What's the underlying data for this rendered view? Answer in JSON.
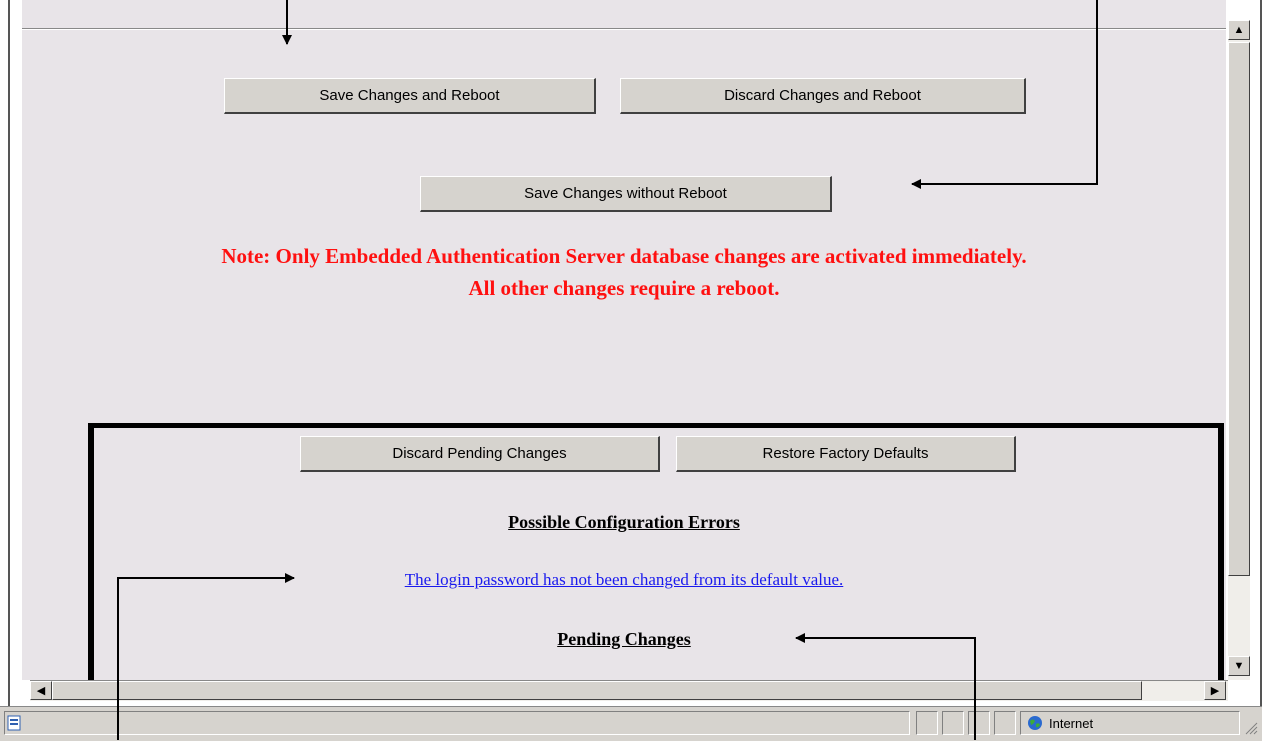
{
  "buttons": {
    "save_reboot": "Save Changes and Reboot",
    "discard_reboot": "Discard Changes and Reboot",
    "save_no_reboot": "Save Changes without Reboot",
    "discard_pending": "Discard Pending Changes",
    "restore_defaults": "Restore Factory Defaults"
  },
  "note": {
    "line1": "Note: Only Embedded Authentication Server database changes are activated immediately.",
    "line2": "All other changes require a reboot."
  },
  "errors": {
    "heading": "Possible Configuration Errors",
    "message": "The login password has not been changed from its default value."
  },
  "pending": {
    "heading": "Pending Changes"
  },
  "status": {
    "zone": "Internet"
  },
  "colors": {
    "note": "#ff1010",
    "link": "#1a1aee",
    "page_bg": "#e8e4e8"
  }
}
